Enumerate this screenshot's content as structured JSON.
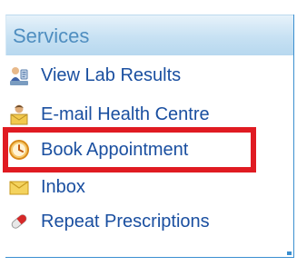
{
  "panel": {
    "title": "Services",
    "items": [
      {
        "label": "View Lab Results",
        "icon": "lab-results-icon"
      },
      {
        "label": "E-mail Health Centre",
        "icon": "email-health-centre-icon"
      },
      {
        "label": "Book Appointment",
        "icon": "clock-icon"
      },
      {
        "label": "Inbox",
        "icon": "envelope-icon"
      },
      {
        "label": "Repeat Prescriptions",
        "icon": "pill-icon"
      }
    ]
  },
  "colors": {
    "link": "#1a4fa0",
    "header_text": "#4f8ec0",
    "highlight": "#e01b22",
    "border": "#3b8fd0"
  }
}
